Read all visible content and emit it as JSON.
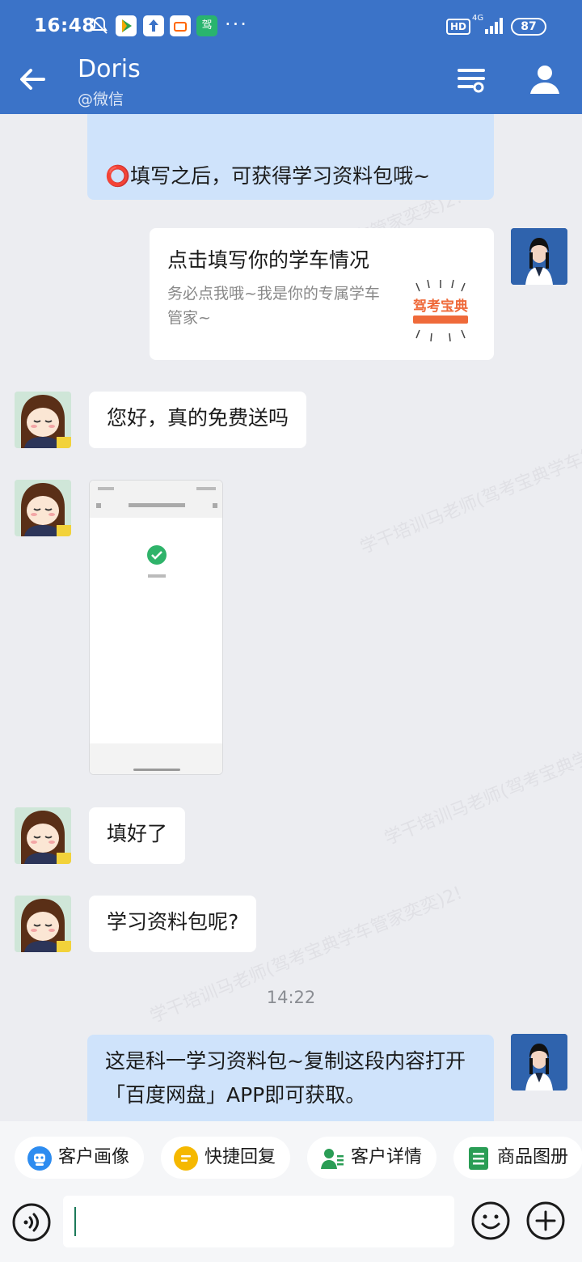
{
  "status_bar": {
    "time": "16:48",
    "app_badge": "驾",
    "more": "···",
    "hd": "HD",
    "network": "4G",
    "battery": "87"
  },
  "header": {
    "back_icon": "arrow-left-icon",
    "title": "Doris",
    "subtitle": "@微信",
    "menu_icon": "list-settings-icon",
    "profile_icon": "person-icon",
    "color": "#3b73c8"
  },
  "messages": {
    "m1_text": "⭕填写之后，可获得学习资料包哦~",
    "card": {
      "title": "点击填写你的学车情况",
      "description": "务必点我哦~我是你的专属学车管家~",
      "thumb_text": "驾考宝典"
    },
    "m3_text": "您好，真的免费送吗",
    "m5_text": "填好了",
    "m6_text": "学习资料包呢?",
    "timestamp": "14:22",
    "m7_text": "这是科一学习资料包~复制这段内容打开「百度网盘」APP即可获取。"
  },
  "watermark": "学干培训马老师(驾考宝典学车管家奕奕)2!",
  "quick_tools": [
    {
      "label": "客户画像",
      "icon": "robot-icon",
      "color": "#2d8cf0"
    },
    {
      "label": "快捷回复",
      "icon": "chat-lines-icon",
      "color": "#f5b800"
    },
    {
      "label": "客户详情",
      "icon": "user-detail-icon",
      "color": "#2a9d55"
    },
    {
      "label": "商品图册",
      "icon": "document-list-icon",
      "color": "#2a9d55"
    }
  ],
  "input": {
    "voice_icon": "voice-icon",
    "emoji_icon": "smiley-icon",
    "plus_icon": "plus-circle-icon"
  }
}
